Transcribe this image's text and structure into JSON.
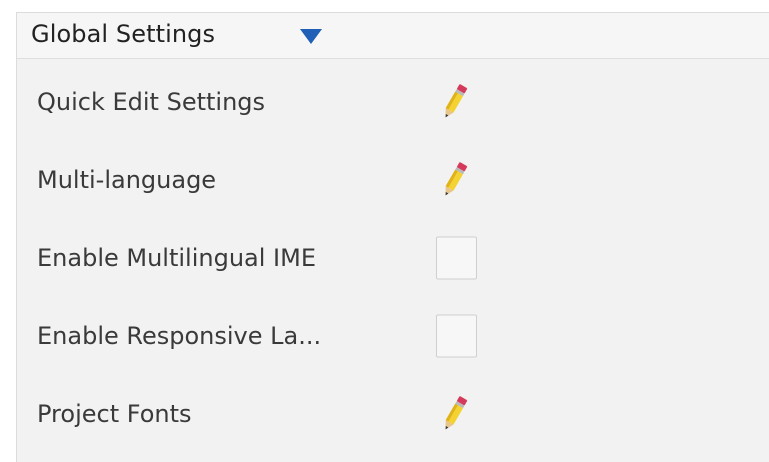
{
  "header": {
    "title": "Global Settings"
  },
  "rows": [
    {
      "label": "Quick Edit Settings",
      "control": "edit",
      "icon": "pencil-icon"
    },
    {
      "label": "Multi-language",
      "control": "edit",
      "icon": "pencil-icon"
    },
    {
      "label": "Enable Multilingual IME",
      "control": "checkbox",
      "checked": false
    },
    {
      "label": "Enable Responsive La...",
      "control": "checkbox",
      "checked": false
    },
    {
      "label": "Project Fonts",
      "control": "edit",
      "icon": "pencil-icon"
    }
  ],
  "colors": {
    "accent_arrow": "#1f5fb8",
    "panel_bg": "#f2f2f2",
    "pencil_body": "#f3d232",
    "pencil_eraser": "#d63a5a"
  }
}
